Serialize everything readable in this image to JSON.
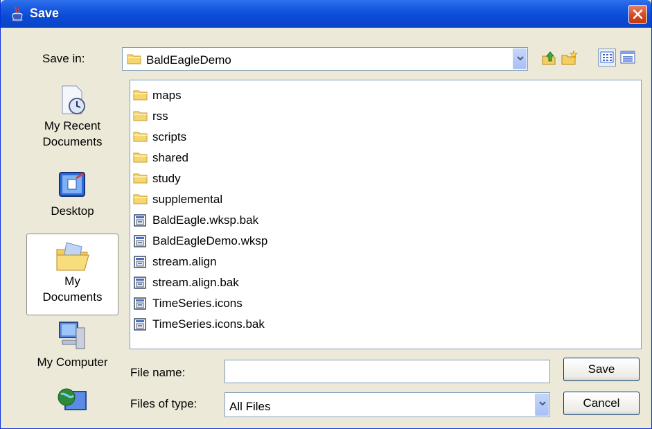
{
  "window": {
    "title": "Save",
    "title_icon": "java-cup-icon",
    "close_icon": "close-icon"
  },
  "save_in": {
    "label": "Save in:",
    "value": "BaldEagleDemo",
    "icon": "folder-icon"
  },
  "toolbar": {
    "icons": [
      "up-one-level-icon",
      "create-new-folder-icon",
      "list-view-icon",
      "details-view-icon"
    ]
  },
  "places": [
    {
      "label_line1": "My Recent",
      "label_line2": "Documents",
      "icon": "recent-documents-icon",
      "selected": false
    },
    {
      "label_line1": "Desktop",
      "label_line2": "",
      "icon": "desktop-icon",
      "selected": false
    },
    {
      "label_line1": "My",
      "label_line2": "Documents",
      "icon": "my-documents-icon",
      "selected": true
    },
    {
      "label_line1": "My Computer",
      "label_line2": "",
      "icon": "my-computer-icon",
      "selected": false
    },
    {
      "label_line1": "",
      "label_line2": "",
      "icon": "network-icon",
      "selected": false
    }
  ],
  "files": [
    {
      "name": "maps",
      "type": "folder"
    },
    {
      "name": "rss",
      "type": "folder"
    },
    {
      "name": "scripts",
      "type": "folder"
    },
    {
      "name": "shared",
      "type": "folder"
    },
    {
      "name": "study",
      "type": "folder"
    },
    {
      "name": "supplemental",
      "type": "folder"
    },
    {
      "name": "BaldEagle.wksp.bak",
      "type": "file"
    },
    {
      "name": "BaldEagleDemo.wksp",
      "type": "file"
    },
    {
      "name": "stream.align",
      "type": "file"
    },
    {
      "name": "stream.align.bak",
      "type": "file"
    },
    {
      "name": "TimeSeries.icons",
      "type": "file"
    },
    {
      "name": "TimeSeries.icons.bak",
      "type": "file"
    }
  ],
  "file_name": {
    "label": "File name:",
    "value": ""
  },
  "files_of_type": {
    "label": "Files of type:",
    "value": "All Files"
  },
  "buttons": {
    "save": "Save",
    "cancel": "Cancel"
  },
  "colors": {
    "titlebar": "#0a4bd6",
    "dialog_bg": "#ece9d8",
    "close_button": "#d4461c",
    "folder": "#f3cf62"
  }
}
